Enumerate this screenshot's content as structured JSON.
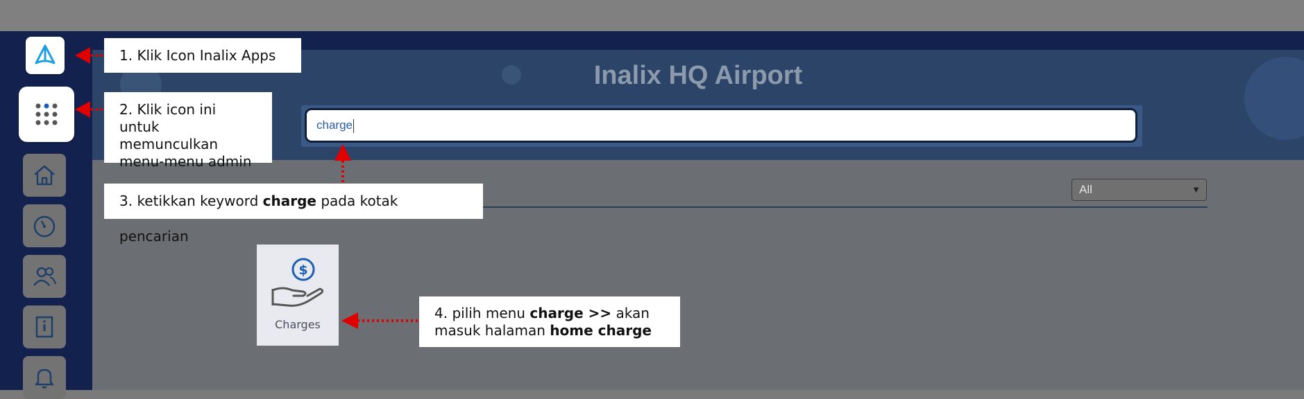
{
  "app": {
    "title": "Inalix HQ Airport"
  },
  "search": {
    "value": "charge"
  },
  "filter": {
    "selected": "All"
  },
  "sidebar": {
    "items": [
      {
        "icon": "inalix-logo-icon"
      },
      {
        "icon": "apps-grid-icon"
      },
      {
        "icon": "home-icon"
      },
      {
        "icon": "dashboard-gauge-icon"
      },
      {
        "icon": "users-icon"
      },
      {
        "icon": "info-book-icon"
      },
      {
        "icon": "bell-icon"
      }
    ]
  },
  "results": [
    {
      "label": "Charges",
      "icon": "dollar-hand-icon"
    }
  ],
  "callouts": {
    "step1": "1. Klik Icon Inalix Apps",
    "step2": [
      "2. Klik icon ini untuk",
      "memunculkan",
      "menu-menu admin"
    ],
    "step3": {
      "pre": "3. ketikkan keyword ",
      "bold": "charge",
      "post": " pada kotak pencarian"
    },
    "step4": {
      "pre": "4. pilih menu ",
      "bold1": "charge >>",
      "mid": " akan",
      "line2pre": "masuk halaman ",
      "bold2": "home charge"
    }
  },
  "colors": {
    "sidebar": "#13214f",
    "accent": "#1a5fb4",
    "arrow": "#e00000"
  }
}
